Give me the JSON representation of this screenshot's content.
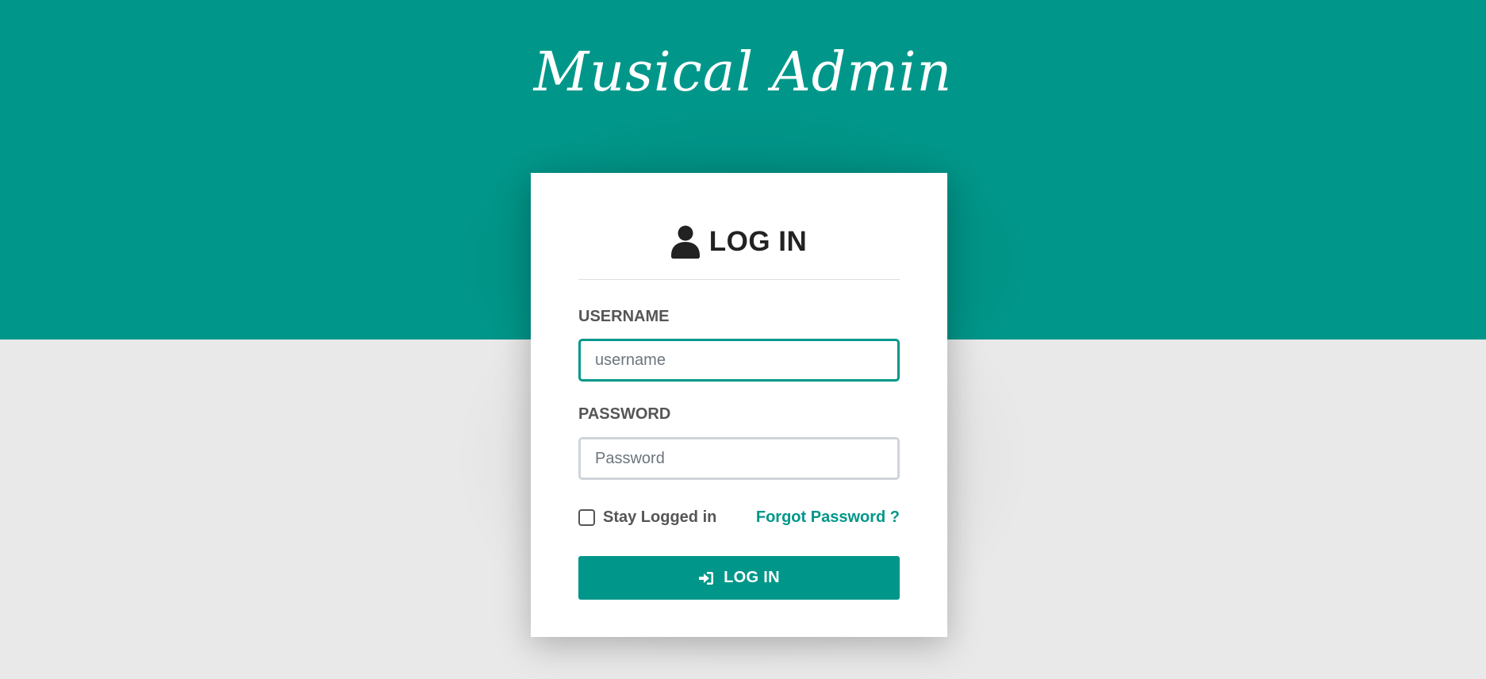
{
  "brand": {
    "title": "Musical Admin"
  },
  "login_card": {
    "title": "LOG IN",
    "title_icon": "user-icon",
    "username": {
      "label": "USERNAME",
      "placeholder": "username",
      "value": ""
    },
    "password": {
      "label": "PASSWORD",
      "placeholder": "Password",
      "value": ""
    },
    "remember": {
      "label": "Stay Logged in",
      "checked": false
    },
    "forgot_link": "Forgot Password ?",
    "submit": {
      "label": "LOG IN",
      "icon": "sign-in-icon"
    }
  },
  "colors": {
    "accent": "#00978a",
    "page_background": "#e9e9e9",
    "card_background": "#ffffff",
    "title_text": "#222222",
    "label_text": "#555555"
  }
}
